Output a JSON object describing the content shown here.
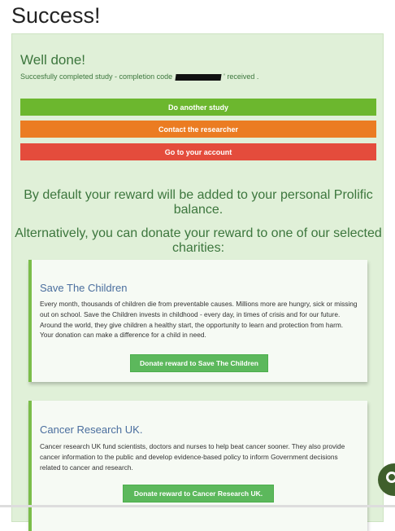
{
  "page": {
    "title": "Success!"
  },
  "panel": {
    "heading": "Well done!",
    "completion_prefix": "Succesfully completed study - completion code",
    "completion_suffix": "' received ."
  },
  "buttons": {
    "another_study": "Do another study",
    "contact": "Contact the researcher",
    "account": "Go to your account"
  },
  "messages": {
    "default_reward": "By default your reward will be added to your personal Prolific balance.",
    "donate_alternative": "Alternatively, you can donate your reward to one of our selected charities:"
  },
  "charities": [
    {
      "name": "Save The Children",
      "description": "Every month, thousands of children die from preventable causes. Millions more are hungry, sick or missing out on school. Save the Children invests in childhood - every day, in times of crisis and for our future. Around the world, they give children a healthy start, the opportunity to learn and protection from harm. Your donation can make a difference for a child in need.",
      "button": "Donate reward to Save The Children"
    },
    {
      "name": "Cancer Research UK.",
      "description": "Cancer research UK fund scientists, doctors and nurses to help beat cancer sooner. They also provide cancer information to the public and develop evidence-based policy to inform Government decisions related to cancer and research.",
      "button": "Donate reward to Cancer Research UK."
    }
  ],
  "colors": {
    "green": "#6cb72e",
    "orange": "#eb7c22",
    "red": "#e44c3c",
    "panel_bg": "#e0f0d8",
    "text_green": "#3c763d"
  },
  "icons": {
    "chat": "chat-bubble-icon"
  }
}
